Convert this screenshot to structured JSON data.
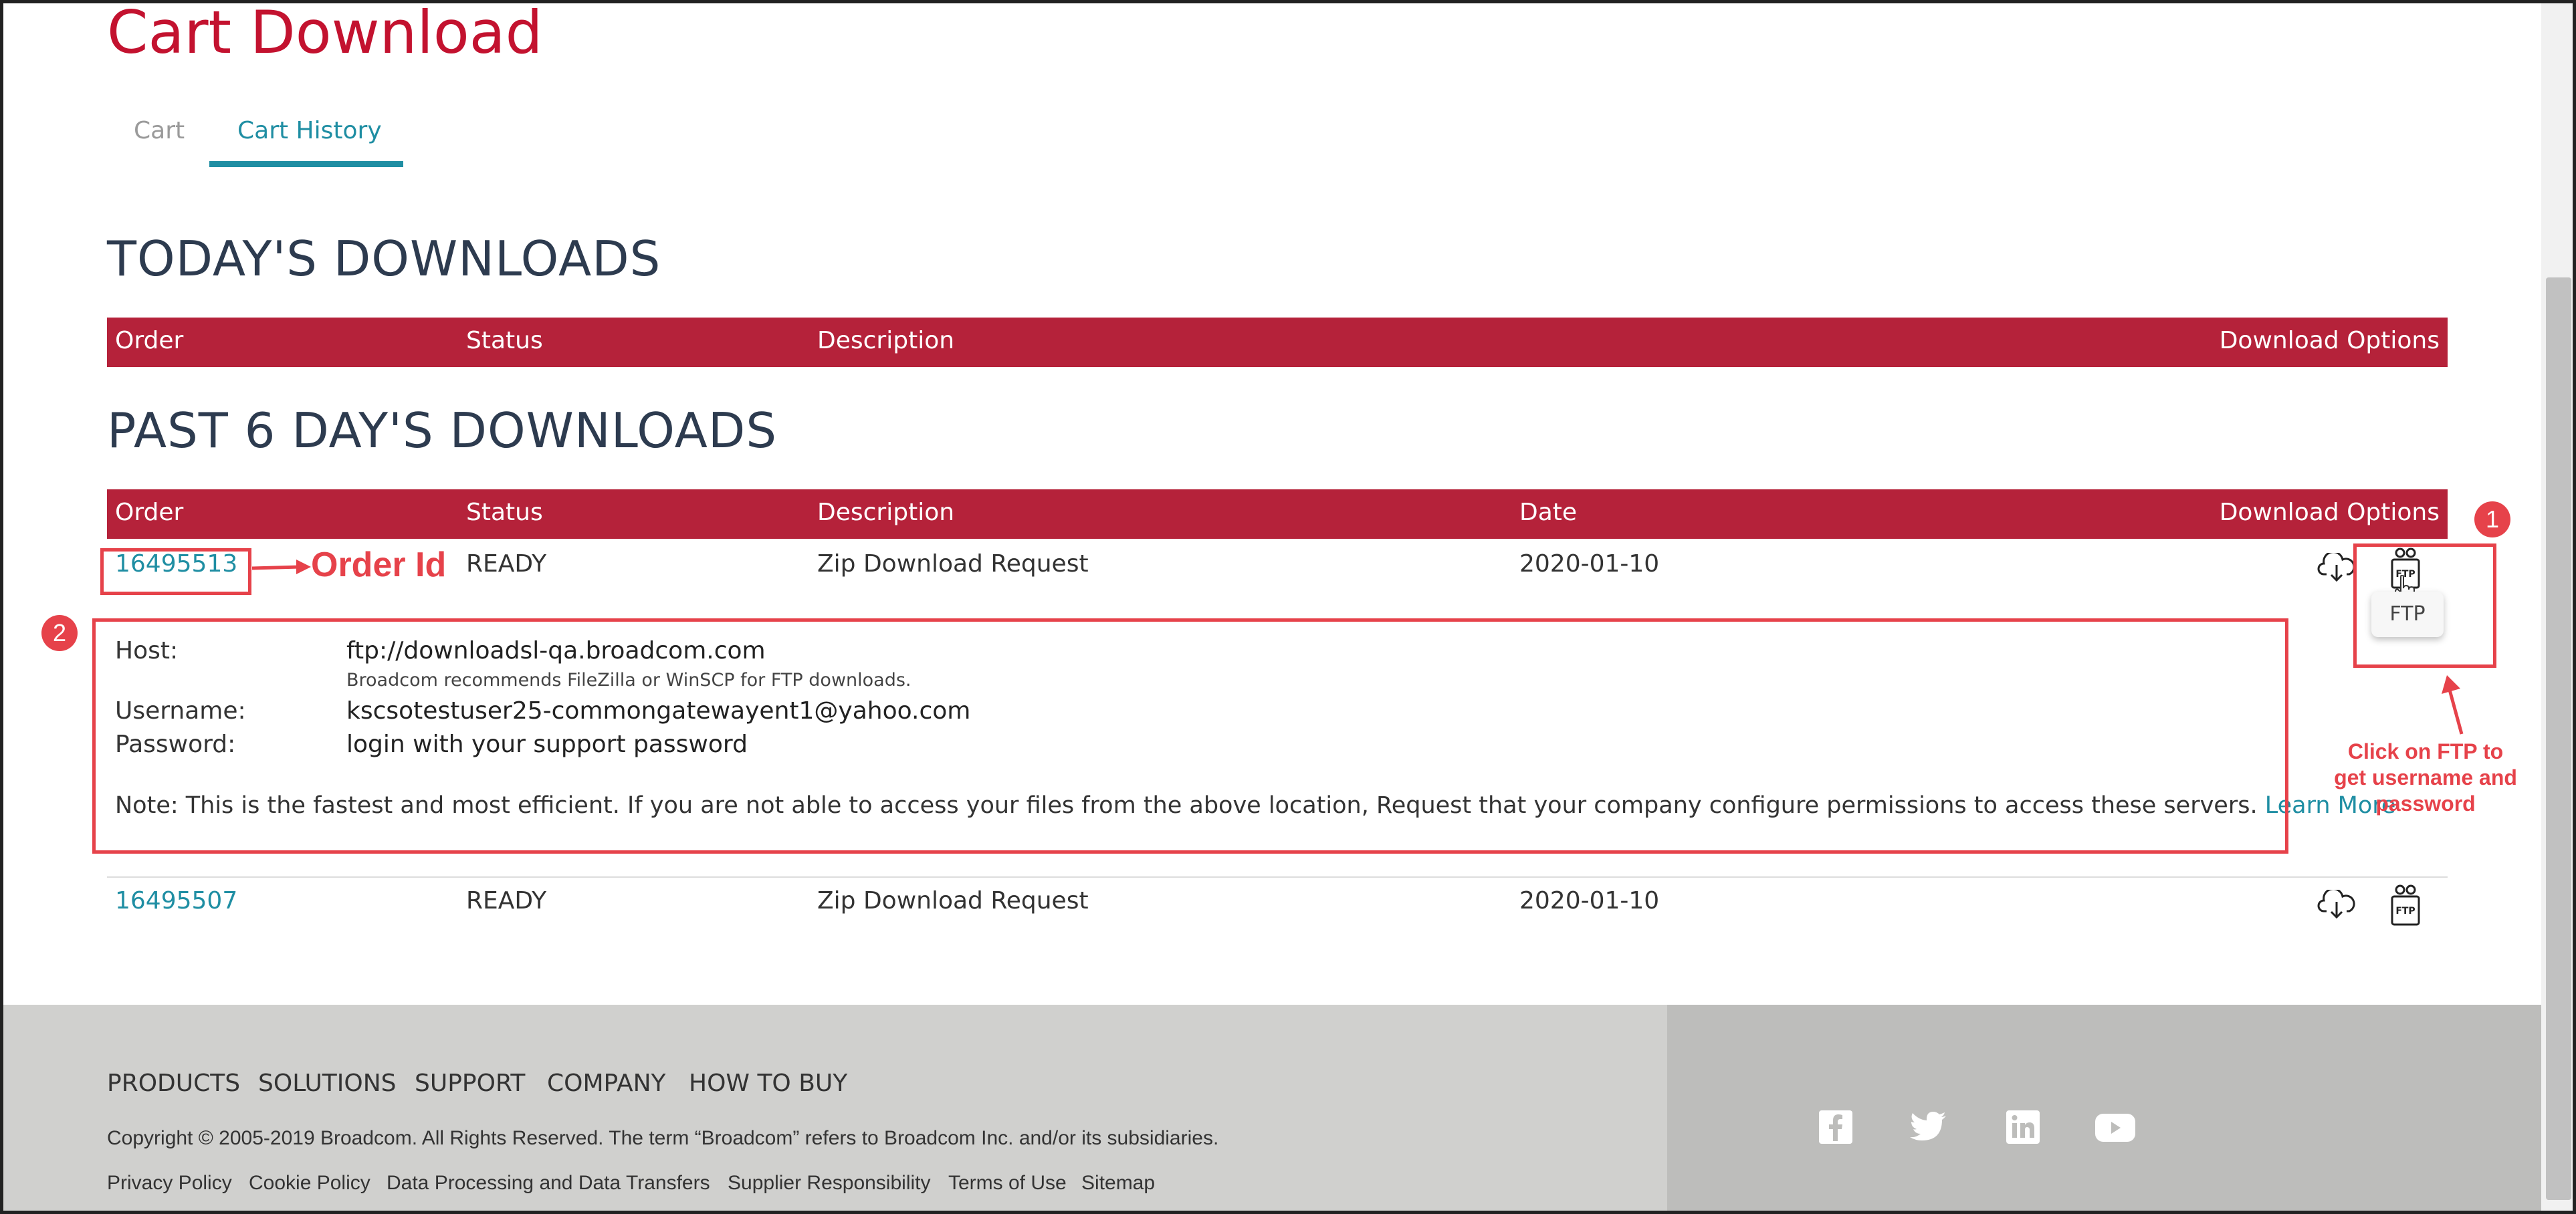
{
  "page": {
    "title": "Cart Download"
  },
  "tabs": [
    {
      "label": "Cart",
      "active": false
    },
    {
      "label": "Cart History",
      "active": true
    }
  ],
  "today": {
    "heading": "TODAY'S DOWNLOADS",
    "columns": {
      "order": "Order",
      "status": "Status",
      "description": "Description",
      "options": "Download Options"
    }
  },
  "past": {
    "heading": "PAST 6 DAY'S DOWNLOADS",
    "columns": {
      "order": "Order",
      "status": "Status",
      "description": "Description",
      "date": "Date",
      "options": "Download Options"
    },
    "rows": [
      {
        "order": "16495513",
        "status": "READY",
        "description": "Zip Download Request",
        "date": "2020-01-10"
      },
      {
        "order": "16495507",
        "status": "READY",
        "description": "Zip Download Request",
        "date": "2020-01-10"
      }
    ]
  },
  "ftp_details": {
    "host_label": "Host:",
    "host_value": "ftp://downloadsl-qa.broadcom.com",
    "recommend": "Broadcom recommends FileZilla or WinSCP for FTP downloads.",
    "username_label": "Username:",
    "username_value": "kscsotestuser25-commongatewayent1@yahoo.com",
    "password_label": "Password:",
    "password_value": "login with your support password",
    "note": "Note: This is the fastest and most efficient. If you are not able to access your files from the above location, Request that your company configure permissions to access these servers.",
    "learn_more": "Learn More"
  },
  "icons": {
    "download": "cloud-download-icon",
    "ftp": "ftp-icon",
    "ftp_text": "FTP"
  },
  "tooltip": {
    "text": "FTP"
  },
  "annotations": {
    "order_id": "Order Id",
    "badge1": "1",
    "badge2": "2",
    "ftp_hint": [
      "Click on FTP to",
      "get username and",
      "password"
    ],
    "color": "#e6424a"
  },
  "footer": {
    "nav": [
      "PRODUCTS",
      "SOLUTIONS",
      "SUPPORT",
      "COMPANY",
      "HOW TO BUY"
    ],
    "copyright": "Copyright © 2005-2019 Broadcom. All Rights Reserved. The term “Broadcom” refers to Broadcom Inc. and/or its subsidiaries.",
    "links": [
      "Privacy Policy",
      "Cookie Policy",
      "Data Processing and Data Transfers",
      "Supplier Responsibility",
      "Terms of Use",
      "Sitemap"
    ],
    "social": [
      "facebook-icon",
      "twitter-icon",
      "linkedin-icon",
      "youtube-icon"
    ]
  },
  "colors": {
    "brand_red": "#c3122f",
    "header_red": "#b5223a",
    "link_teal": "#1f8ea3",
    "heading_navy": "#2d3b4f"
  }
}
